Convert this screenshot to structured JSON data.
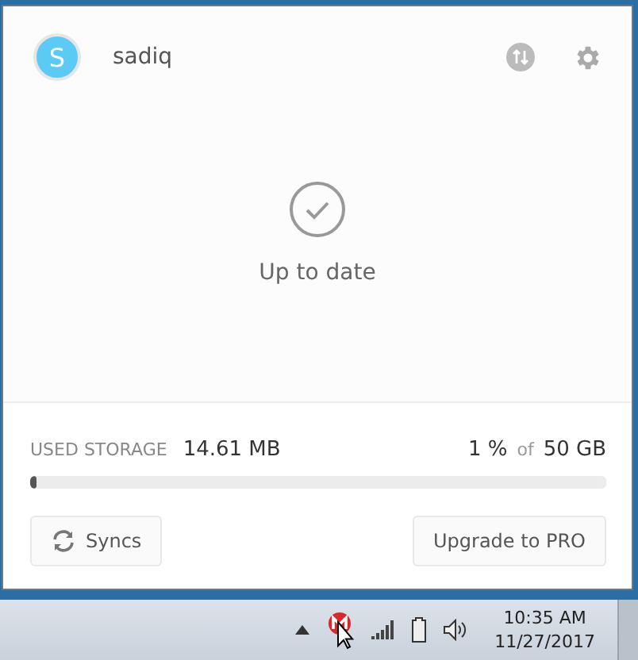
{
  "account": {
    "avatar_letter": "S",
    "name": "sadiq"
  },
  "status": {
    "text": "Up to date"
  },
  "storage": {
    "label": "USED STORAGE",
    "used": "14.61 MB",
    "percent": "1 %",
    "of": "of",
    "total": "50 GB",
    "level": 0.01
  },
  "buttons": [
    {
      "kind": "syncs",
      "label": "Syncs"
    },
    {
      "kind": "upgrade",
      "label": "Upgrade to PRO"
    }
  ],
  "taskbar": {
    "time": "10:35 AM",
    "date": "11/27/2017"
  }
}
